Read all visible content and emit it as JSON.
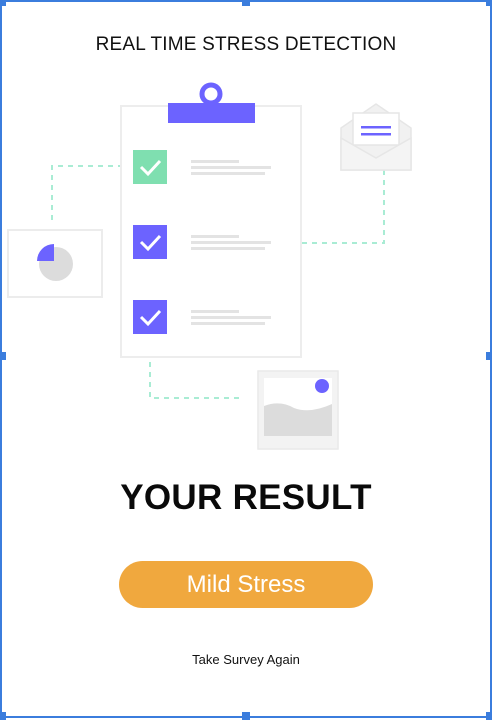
{
  "header": {
    "title": "REAL TIME STRESS DETECTION"
  },
  "result": {
    "heading": "YOUR RESULT",
    "value": "Mild Stress",
    "retake_label": "Take Survey Again"
  },
  "illustration": {
    "checklist_items": [
      {
        "checked": true,
        "color": "#7fdfb0"
      },
      {
        "checked": true,
        "color": "#6c63ff"
      },
      {
        "checked": true,
        "color": "#6c63ff"
      }
    ],
    "icons": [
      "clipboard-icon",
      "pie-chart-icon",
      "envelope-icon",
      "image-icon",
      "check-icon"
    ]
  },
  "colors": {
    "accent": "#6c63ff",
    "mint": "#7fdfb0",
    "button": "#f0a83e",
    "frame": "#3b7ddd"
  }
}
